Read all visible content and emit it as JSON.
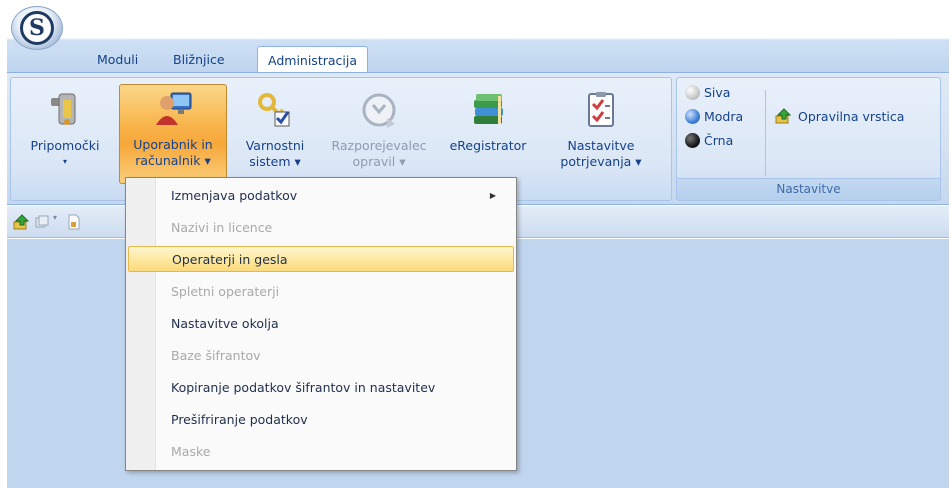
{
  "tabs": [
    {
      "label": "Moduli"
    },
    {
      "label": "Bližnjice"
    },
    {
      "label": "Administracija"
    }
  ],
  "ribbon": {
    "buttons": [
      {
        "label1": "Pripomočki",
        "label2": "▾",
        "icon": "tools-icon"
      },
      {
        "label1": "Uporabnik in",
        "label2": "računalnik ▾",
        "icon": "user-computer-icon"
      },
      {
        "label1": "Varnostni",
        "label2": "sistem ▾",
        "icon": "security-key-icon"
      },
      {
        "label1": "Razporejevalec",
        "label2": "opravil ▾",
        "icon": "scheduler-icon"
      },
      {
        "label1": "eRegistrator",
        "label2": "",
        "icon": "books-icon"
      },
      {
        "label1": "Nastavitve",
        "label2": "potrjevanja ▾",
        "icon": "checklist-icon"
      }
    ],
    "themes": [
      {
        "label": "Siva",
        "color": "#c8c8c8"
      },
      {
        "label": "Modra",
        "color": "#3e7fd6"
      },
      {
        "label": "Črna",
        "color": "#1a1a1a"
      }
    ],
    "statusbar_toggle": "Opravilna vrstica",
    "group_label": "Nastavitve"
  },
  "menu": {
    "items": [
      {
        "label": "Izmenjava podatkov",
        "state": "enabled",
        "submenu": true
      },
      {
        "label": "Nazivi in licence",
        "state": "disabled"
      },
      {
        "label": "Operaterji in gesla",
        "state": "hover"
      },
      {
        "label": "Spletni operaterji",
        "state": "disabled"
      },
      {
        "label": "Nastavitve okolja",
        "state": "enabled"
      },
      {
        "label": "Baze šifrantov",
        "state": "disabled"
      },
      {
        "label": "Kopiranje podatkov šifrantov in nastavitev",
        "state": "enabled"
      },
      {
        "label": "Prešifriranje podatkov",
        "state": "enabled"
      },
      {
        "label": "Maske",
        "state": "disabled"
      }
    ]
  },
  "colors": {
    "accent_hover": "#fbd97a",
    "ribbon_blue": "#c0d5ee",
    "text_blue": "#15428b"
  }
}
